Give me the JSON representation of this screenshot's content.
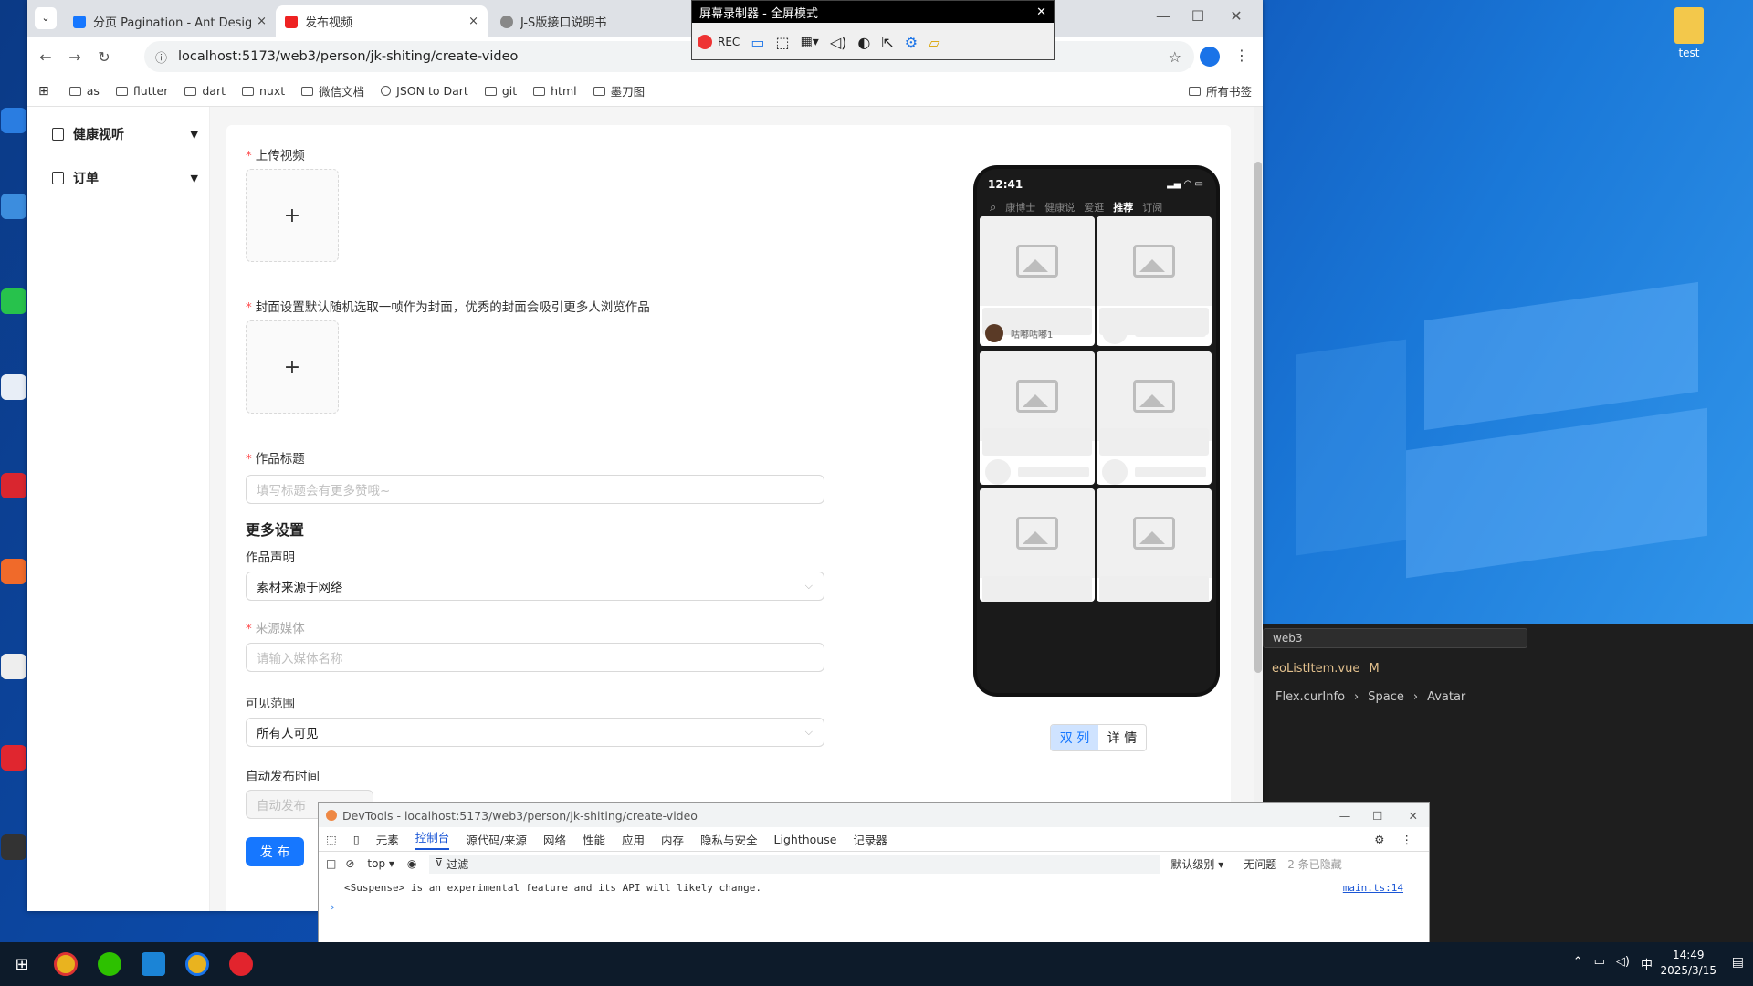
{
  "browser": {
    "tabs": [
      {
        "label": "分页 Pagination - Ant Design",
        "close": "×"
      },
      {
        "label": "发布视频",
        "close": "×"
      },
      {
        "label": "J-S版接口说明书",
        "close": ""
      }
    ],
    "url": "localhost:5173/web3/person/jk-shiting/create-video",
    "bookmarks": [
      "as",
      "flutter",
      "dart",
      "nuxt",
      "微信文档",
      "JSON to Dart",
      "git",
      "html",
      "墨刀图"
    ],
    "all_bookmarks": "所有书签"
  },
  "sidebar": {
    "items": [
      {
        "label": "健康视听"
      },
      {
        "label": "订单"
      }
    ]
  },
  "form": {
    "upload_video_label": "上传视频",
    "cover_label": "封面设置默认随机选取一帧作为封面，优秀的封面会吸引更多人浏览作品",
    "plus": "+",
    "title_label": "作品标题",
    "title_placeholder": "填写标题会有更多赞哦~",
    "more_settings": "更多设置",
    "statement_label": "作品声明",
    "statement_value": "素材来源于网络",
    "source_label": "来源媒体",
    "source_placeholder": "请输入媒体名称",
    "visibility_label": "可见范围",
    "visibility_value": "所有人可见",
    "autopub_label": "自动发布时间",
    "autopub_placeholder": "自动发布",
    "publish_button": "发 布"
  },
  "phone": {
    "time": "12:41",
    "tabs": [
      "康博士",
      "健康说",
      "爱逛",
      "推荐",
      "订阅"
    ],
    "active_tab": "推荐",
    "user_name": "咕嘟咕嘟1"
  },
  "view_modes": {
    "double": "双 列",
    "detail": "详 情"
  },
  "recorder": {
    "title": "屏幕录制器 - 全屏模式",
    "rec": "REC"
  },
  "devtools": {
    "title": "DevTools - localhost:5173/web3/person/jk-shiting/create-video",
    "tabs": [
      "元素",
      "控制台",
      "源代码/来源",
      "网络",
      "性能",
      "应用",
      "内存",
      "隐私与安全",
      "Lighthouse",
      "记录器"
    ],
    "active_tab": "控制台",
    "context": "top ▾",
    "filter": "过滤",
    "level": "默认级别 ▾",
    "issues": "无问题",
    "hidden": "2 条已隐藏",
    "log_message": "<Suspense> is an experimental feature and its API will likely change.",
    "log_source": "main.ts:14"
  },
  "vscode": {
    "search": "web3",
    "file": "eoListItem.vue",
    "file_status": "M",
    "breadcrumb": [
      "Flex.curInfo",
      "Space",
      "Avatar"
    ]
  },
  "desktop": {
    "folder_label": "test"
  },
  "taskbar": {
    "ime": "中",
    "time": "14:49",
    "date": "2025/3/15"
  }
}
